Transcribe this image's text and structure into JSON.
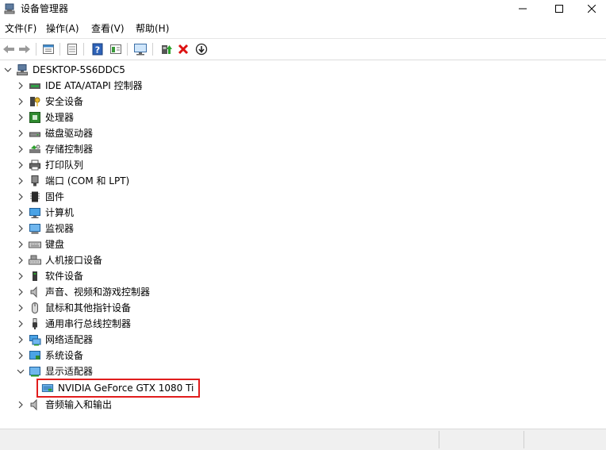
{
  "window": {
    "title": "设备管理器",
    "buttons": {
      "minimize_label": "—",
      "maximize_label": "□",
      "close_label": "✕"
    }
  },
  "menu": {
    "items": [
      "文件(F)",
      "操作(A)",
      "查看(V)",
      "帮助(H)"
    ]
  },
  "toolbar": {
    "buttons": [
      "back-icon",
      "forward-icon",
      "properties-view-icon",
      "list-view-icon",
      "help-icon",
      "details-icon",
      "monitor-scan-icon",
      "update-driver-icon",
      "uninstall-icon",
      "disable-device-icon"
    ]
  },
  "tree": {
    "root": "DESKTOP-5S6DDC5",
    "categories": [
      {
        "label": "IDE ATA/ATAPI 控制器",
        "icon": "ide-controller-icon",
        "expanded": false
      },
      {
        "label": "安全设备",
        "icon": "security-key-icon",
        "expanded": false
      },
      {
        "label": "处理器",
        "icon": "processor-icon",
        "expanded": false
      },
      {
        "label": "磁盘驱动器",
        "icon": "disk-drive-icon",
        "expanded": false
      },
      {
        "label": "存储控制器",
        "icon": "storage-controller-icon",
        "expanded": false
      },
      {
        "label": "打印队列",
        "icon": "printer-icon",
        "expanded": false
      },
      {
        "label": "端口 (COM 和 LPT)",
        "icon": "port-icon",
        "expanded": false
      },
      {
        "label": "固件",
        "icon": "firmware-icon",
        "expanded": false
      },
      {
        "label": "计算机",
        "icon": "computer-icon",
        "expanded": false
      },
      {
        "label": "监视器",
        "icon": "monitor-icon",
        "expanded": false
      },
      {
        "label": "键盘",
        "icon": "keyboard-icon",
        "expanded": false
      },
      {
        "label": "人机接口设备",
        "icon": "hid-icon",
        "expanded": false
      },
      {
        "label": "软件设备",
        "icon": "software-device-icon",
        "expanded": false
      },
      {
        "label": "声音、视频和游戏控制器",
        "icon": "speaker-icon",
        "expanded": false
      },
      {
        "label": "鼠标和其他指针设备",
        "icon": "mouse-icon",
        "expanded": false
      },
      {
        "label": "通用串行总线控制器",
        "icon": "usb-icon",
        "expanded": false
      },
      {
        "label": "网络适配器",
        "icon": "network-adapter-icon",
        "expanded": false
      },
      {
        "label": "系统设备",
        "icon": "system-device-icon",
        "expanded": false
      },
      {
        "label": "显示适配器",
        "icon": "display-adapter-icon",
        "expanded": true,
        "children": [
          {
            "label": "NVIDIA GeForce GTX 1080 Ti",
            "icon": "gpu-icon",
            "highlighted": true
          }
        ]
      },
      {
        "label": "音频输入和输出",
        "icon": "audio-io-icon",
        "expanded": false
      }
    ]
  },
  "colors": {
    "highlight_border": "#e11d1d",
    "accent_blue": "#1e6fd9"
  }
}
